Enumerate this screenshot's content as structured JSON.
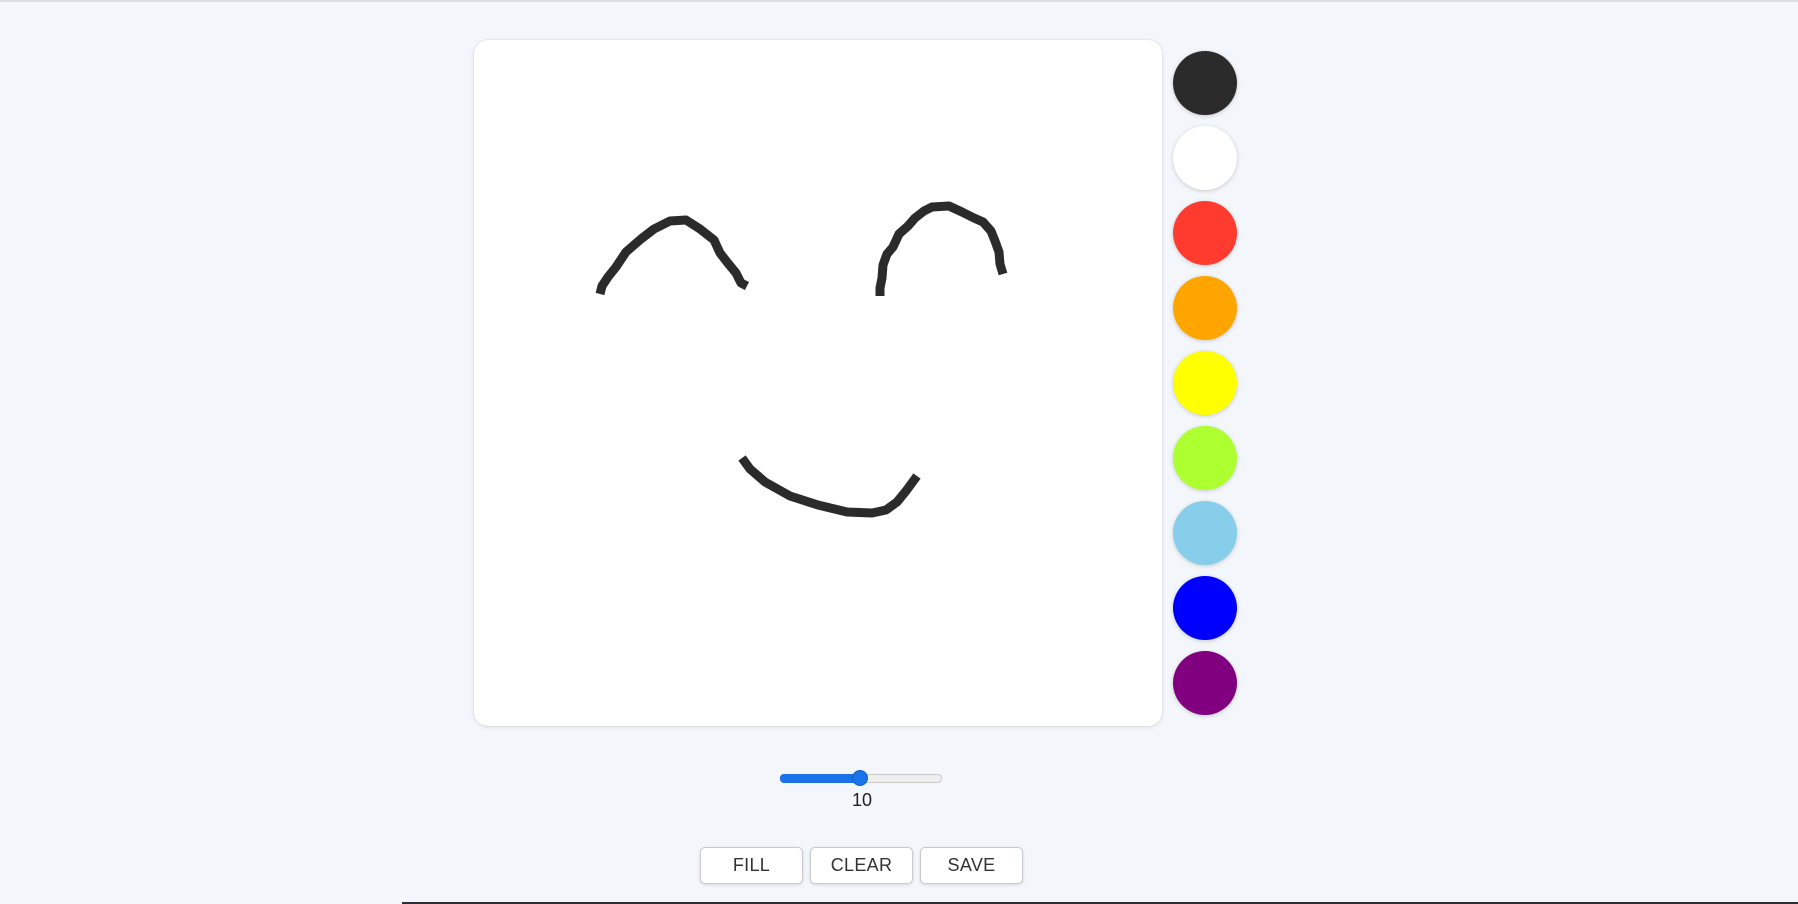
{
  "drawing": {
    "stroke_color": "#2b2b2b",
    "strokes": [
      "left-eye",
      "right-eye",
      "mouth"
    ]
  },
  "palette": {
    "colors": [
      {
        "name": "black",
        "hex": "#2b2b2b"
      },
      {
        "name": "white",
        "hex": "#ffffff"
      },
      {
        "name": "red",
        "hex": "#ff3b30"
      },
      {
        "name": "orange",
        "hex": "#ffa500"
      },
      {
        "name": "yellow",
        "hex": "#ffff00"
      },
      {
        "name": "yellow-green",
        "hex": "#adff2f"
      },
      {
        "name": "sky-blue",
        "hex": "#87ceeb"
      },
      {
        "name": "blue",
        "hex": "#0000ff"
      },
      {
        "name": "purple",
        "hex": "#800080"
      }
    ]
  },
  "brush": {
    "size_value": "10",
    "slider_fraction": 0.5,
    "accent_color": "#1a73e8"
  },
  "toolbar": {
    "fill_label": "FILL",
    "clear_label": "CLEAR",
    "save_label": "SAVE"
  }
}
